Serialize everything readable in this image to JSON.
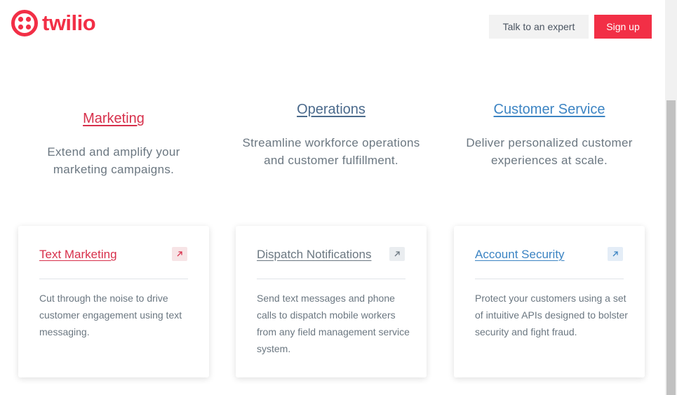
{
  "header": {
    "logo_text": "twilio",
    "talk_button": "Talk to an expert",
    "signup_button": "Sign up"
  },
  "columns": [
    {
      "title": "Marketing",
      "description": "Extend and amplify your marketing campaigns."
    },
    {
      "title": "Operations",
      "description": "Streamline workforce operations and customer fulfillment."
    },
    {
      "title": "Customer Service",
      "description": "Deliver personalized customer experiences at scale."
    }
  ],
  "cards": [
    {
      "title": "Text Marketing",
      "description": "Cut through the noise to drive customer engagement using text messaging.",
      "icon": "arrow-up-right-icon"
    },
    {
      "title": "Dispatch Notifications",
      "description": "Send text messages and phone calls to dispatch mobile workers from any field management service system.",
      "icon": "arrow-up-right-icon"
    },
    {
      "title": "Account Security",
      "description": "Protect your customers using a set of intuitive APIs designed to bolster security and fight fraud.",
      "icon": "arrow-up-right-icon"
    }
  ],
  "colors": {
    "brand": "#f22f46",
    "marketing": "#d7304b",
    "operations": "#4b6a8c",
    "customer_service": "#3c84c3"
  }
}
